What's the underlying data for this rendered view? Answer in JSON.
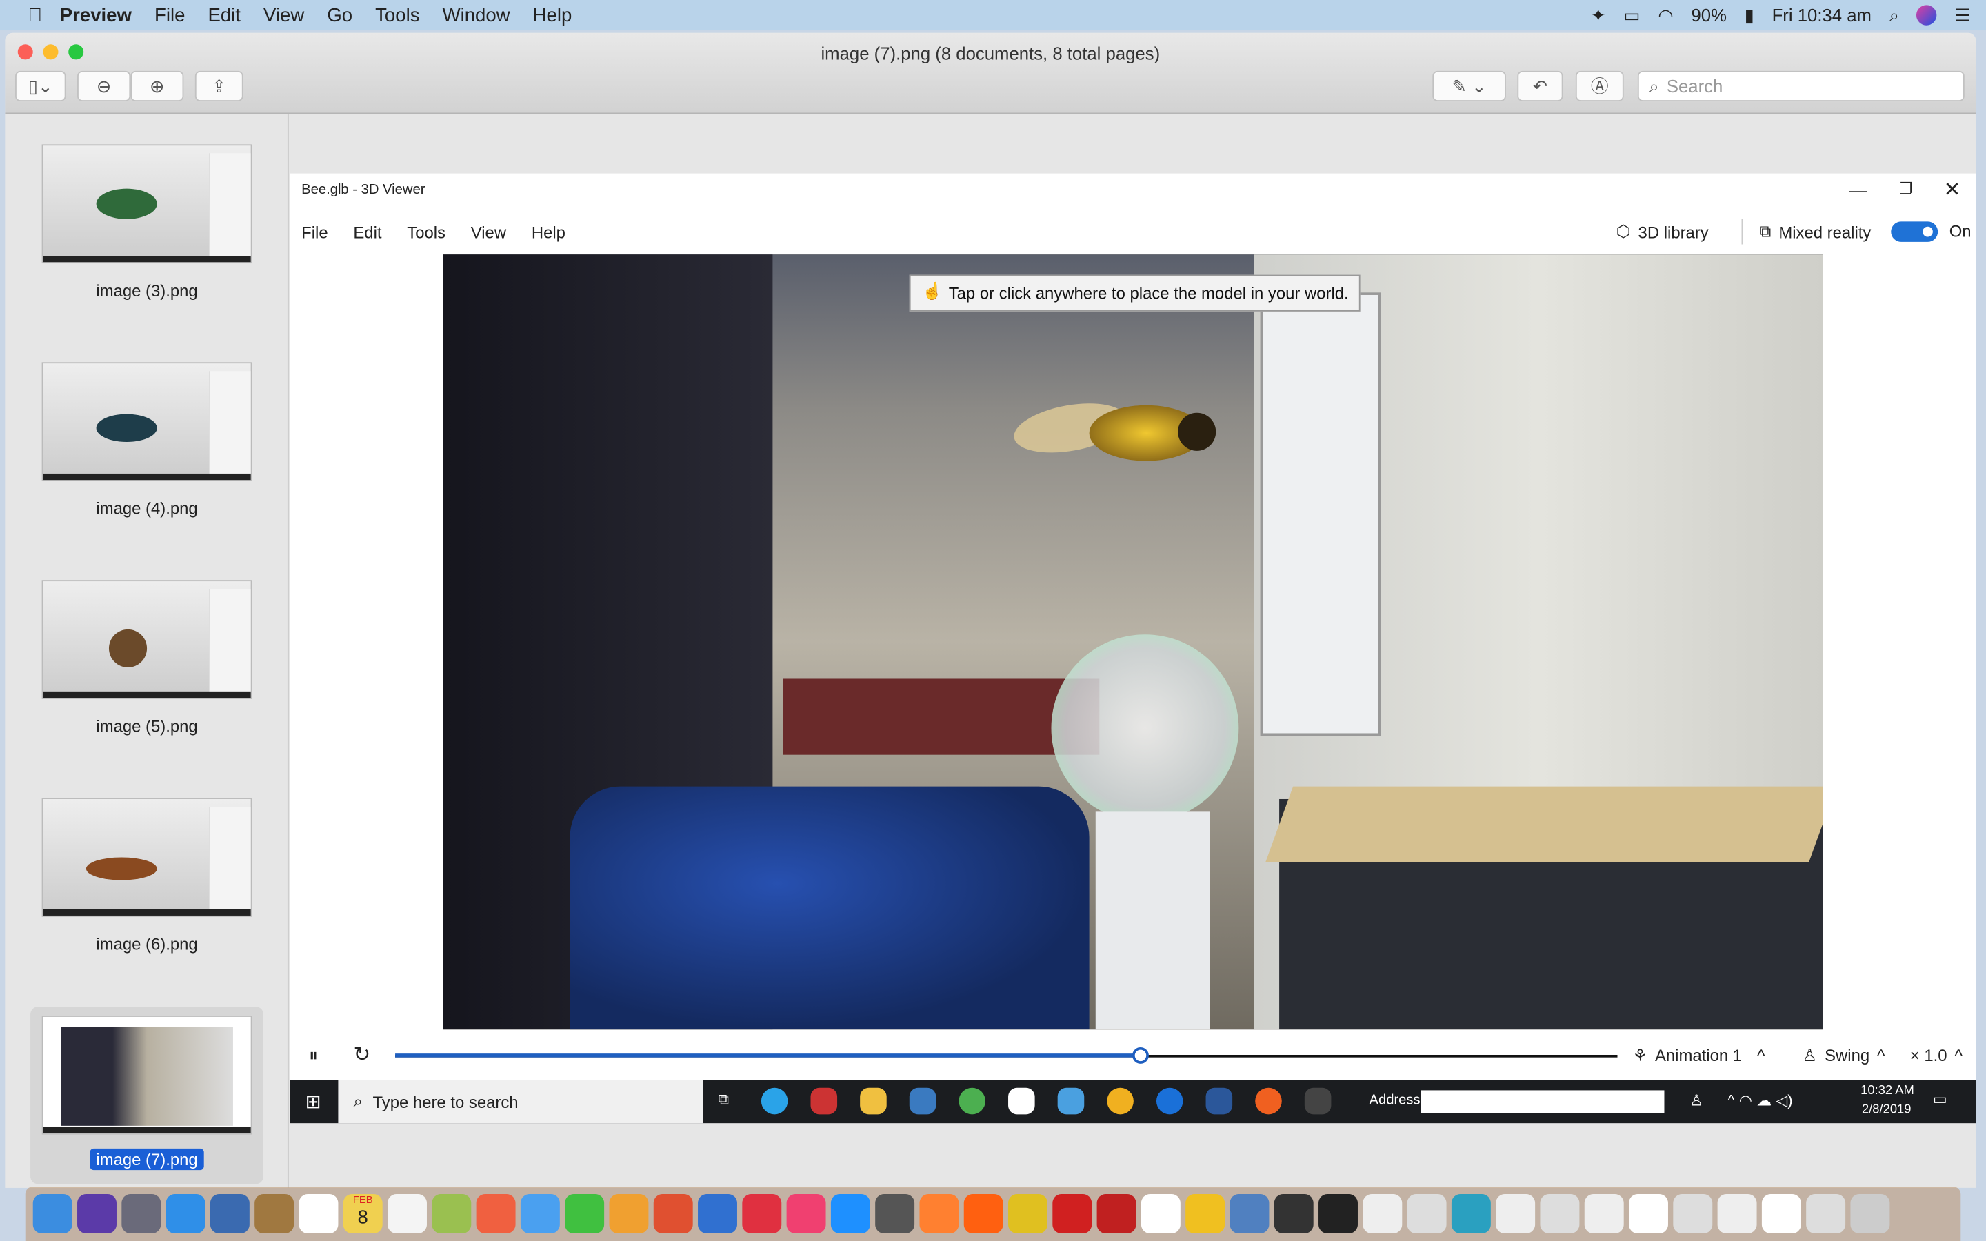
{
  "menubar": {
    "app": "Preview",
    "items": [
      "File",
      "Edit",
      "View",
      "Go",
      "Tools",
      "Window",
      "Help"
    ],
    "battery": "90%",
    "clock": "Fri 10:34 am"
  },
  "window": {
    "title": "image (7).png (8 documents, 8 total pages)",
    "search_placeholder": "Search"
  },
  "sidebar": {
    "thumbnails": [
      {
        "label": "image (3).png",
        "bug": "#2f6a3a"
      },
      {
        "label": "image (4).png",
        "bug": "#1e3d4a"
      },
      {
        "label": "image (5).png",
        "bug": "#6b4a2a"
      },
      {
        "label": "image (6).png",
        "bug": "#8a4a20"
      },
      {
        "label": "image (7).png",
        "selected": true
      }
    ]
  },
  "viewer": {
    "title": "Bee.glb - 3D Viewer",
    "menu": [
      "File",
      "Edit",
      "Tools",
      "View",
      "Help"
    ],
    "library": "3D library",
    "mixed_reality": "Mixed reality",
    "toggle_state": "On",
    "toggle_on": true,
    "tip": "Tap or click anywhere to place the model in your world.",
    "animation": "Animation 1",
    "mode": "Swing",
    "speed": "× 1.0",
    "progress": 0.61
  },
  "taskbar": {
    "search": "Type here to search",
    "address_label": "Address",
    "time": "10:32 AM",
    "date": "2/8/2019"
  },
  "dock": {
    "calendar_month": "FEB",
    "calendar_day": "8",
    "colors": [
      "#3b8de0",
      "#5b3aa8",
      "#6a6a7a",
      "#2f8fe8",
      "#3a6ab0",
      "#a07840",
      "#fff",
      "#f0d050",
      "#f4f4f4",
      "#9ac050",
      "#f06040",
      "#4aa0f0",
      "#40c040",
      "#f0a030",
      "#e05030",
      "#3070d0",
      "#e03040",
      "#f04070",
      "#1e90ff",
      "#555",
      "#ff8030",
      "#ff6010",
      "#e0c020",
      "#d02020",
      "#c02020",
      "#fff",
      "#f0c020",
      "#5080c0",
      "#333",
      "#222",
      "#eee",
      "#ddd",
      "#2aa0c0",
      "#eee",
      "#ddd",
      "#eee",
      "#fff",
      "#ddd",
      "#eee",
      "#fff",
      "#ddd",
      "#ccc"
    ]
  }
}
